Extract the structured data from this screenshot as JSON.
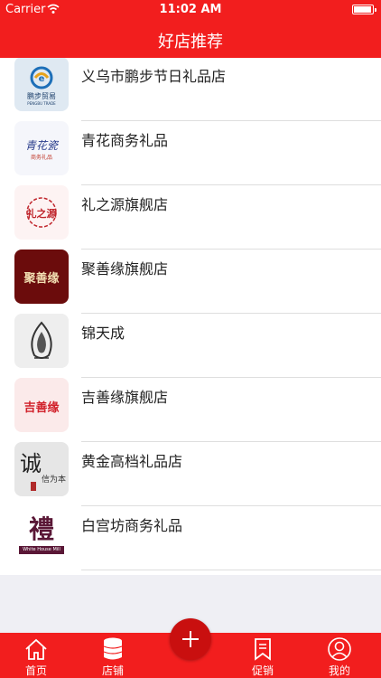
{
  "status_bar": {
    "carrier": "Carrier",
    "time": "11:02 AM"
  },
  "nav": {
    "title": "好店推荐"
  },
  "stores": [
    {
      "name": "义乌市鹏步节日礼品店",
      "logo_text": "鹏步贸易",
      "logo_subtext": "PENGBU TRADE",
      "icon": "pengbu-trade-logo"
    },
    {
      "name": "青花商务礼品",
      "logo_text": "青花瓷",
      "logo_subtext": "商务礼品",
      "icon": "qinghua-logo"
    },
    {
      "name": "礼之源旗舰店",
      "logo_text": "礼之源",
      "logo_subtext": "",
      "icon": "lizhiyuan-logo"
    },
    {
      "name": "聚善缘旗舰店",
      "logo_text": "聚善缘",
      "logo_subtext": "",
      "icon": "jushanyuan-logo"
    },
    {
      "name": "锦天成",
      "logo_text": "",
      "logo_subtext": "",
      "icon": "jintiancheng-logo"
    },
    {
      "name": "吉善缘旗舰店",
      "logo_text": "吉善缘",
      "logo_subtext": "",
      "icon": "jishanyuan-logo"
    },
    {
      "name": "黄金高档礼品店",
      "logo_text": "诚",
      "logo_subtext": "信为本",
      "icon": "cheng-calligraphy-logo"
    },
    {
      "name": "白宫坊商务礼品",
      "logo_text": "禮",
      "logo_subtext": "White House Mill",
      "icon": "white-house-mill-logo"
    }
  ],
  "tabs": [
    {
      "label": "首页",
      "icon": "home-icon"
    },
    {
      "label": "店铺",
      "icon": "store-database-icon"
    },
    {
      "label": "促销",
      "icon": "promo-bookmark-icon"
    },
    {
      "label": "我的",
      "icon": "user-profile-icon"
    }
  ],
  "fab": {
    "icon": "plus-icon"
  },
  "colors": {
    "primary_red": "#f21e1e",
    "fab_red": "#c90f0f",
    "background": "#efeff4"
  }
}
